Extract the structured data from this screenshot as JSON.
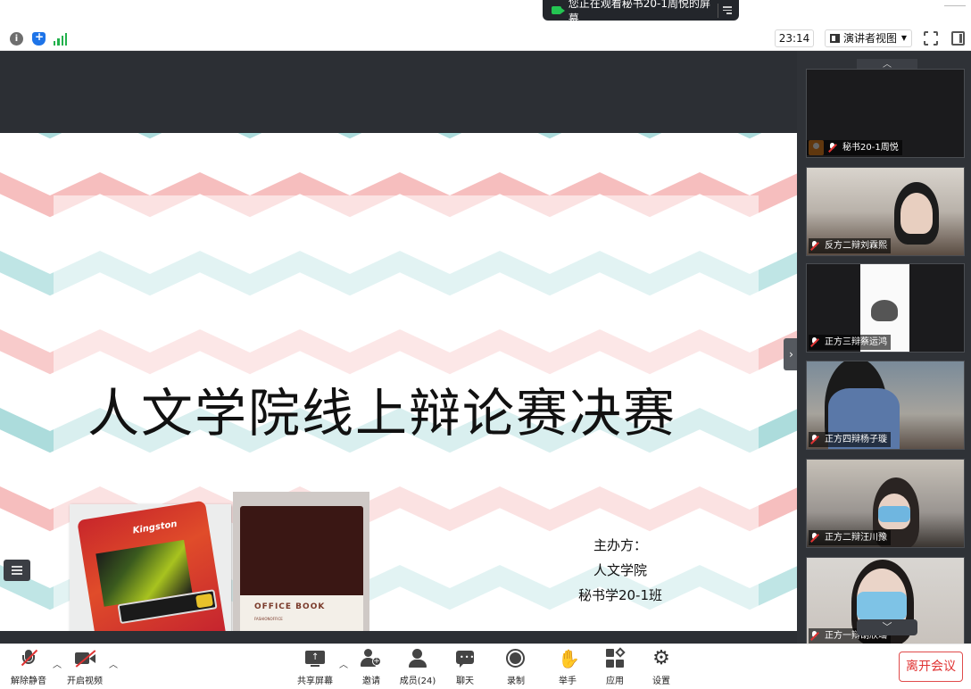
{
  "banner": {
    "text": "您正在观看秘书20-1周悦的屏幕"
  },
  "toolbar": {
    "time": "23:14",
    "view_label": "演讲者视图",
    "view_caret": "▼"
  },
  "slide": {
    "title": "人文学院线上辩论赛决赛",
    "organizer_label": "主办方：",
    "organizer_1": "人文学院",
    "organizer_2": "秘书学20-1班",
    "usb_brand": "Kingston",
    "book_title": "OFFICE BOOK",
    "book_sub": "FASHIONOFFICE"
  },
  "participants": [
    {
      "name": "秘书20-1周悦"
    },
    {
      "name": "反方二辩刘霖熙"
    },
    {
      "name": "正方三辩蔡运鸿"
    },
    {
      "name": "正方四辩杨子璇"
    },
    {
      "name": "正方二辩汪川豫"
    },
    {
      "name": "正方一辩胡欣瑶"
    }
  ],
  "bottom": {
    "unmute": "解除静音",
    "video": "开启视频",
    "share": "共享屏幕",
    "invite": "邀请",
    "members": "成员(24)",
    "chat": "聊天",
    "record": "录制",
    "raise_hand": "举手",
    "apps": "应用",
    "settings": "设置",
    "leave": "离开会议"
  },
  "colors": {
    "leave": "#e03232",
    "teal": "#8fd0d0",
    "pink": "#f2a6a6",
    "panel": "#2f3237"
  }
}
